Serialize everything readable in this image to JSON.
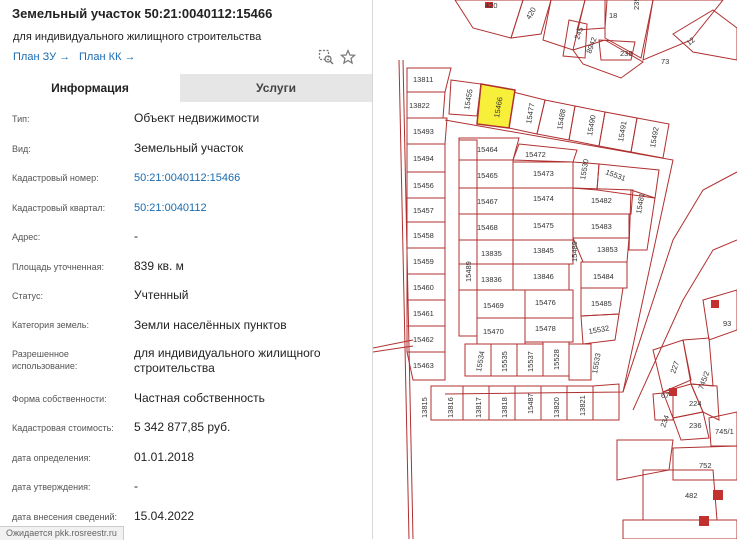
{
  "header": {
    "title": "Земельный участок 50:21:0040112:15466",
    "subtitle": "для индивидуального жилищного строительства",
    "plan_zu": "План ЗУ →",
    "plan_kk": "План КК →"
  },
  "tabs": [
    {
      "label": "Информация",
      "active": true
    },
    {
      "label": "Услуги",
      "active": false
    }
  ],
  "rows": [
    {
      "label": "Тип:",
      "value": "Объект недвижимости"
    },
    {
      "label": "Вид:",
      "value": "Земельный участок"
    },
    {
      "label": "Кадастровый номер:",
      "value": "50:21:0040112:15466"
    },
    {
      "label": "Кадастровый квартал:",
      "value": "50:21:0040112"
    },
    {
      "label": "Адрес:",
      "value": "-"
    },
    {
      "label": "Площадь уточненная:",
      "value": "839 кв. м"
    },
    {
      "label": "Статус:",
      "value": "Учтенный"
    },
    {
      "label": "Категория земель:",
      "value": "Земли населённых пунктов"
    },
    {
      "label": "Разрешенное использование:",
      "value": "для индивидуального жилищного строительства"
    },
    {
      "label": "Форма собственности:",
      "value": "Частная собственность"
    },
    {
      "label": "Кадастровая стоимость:",
      "value": "5 342 877,85 руб."
    },
    {
      "label": "дата определения:",
      "value": "01.01.2018"
    },
    {
      "label": "дата утверждения:",
      "value": "-"
    },
    {
      "label": "дата внесения сведений:",
      "value": "15.04.2022"
    }
  ],
  "status_bar": "Ожидается pkk.rosreestr.ru",
  "map": {
    "highlight_color": "#f7ef3a",
    "boundary_color": "#b03030",
    "plots": [
      "420",
      "420",
      "18",
      "239",
      "245",
      "8942",
      "238",
      "73",
      "12",
      "13811",
      "13822",
      "15455",
      "15466",
      "15477",
      "15488",
      "15490",
      "15491",
      "15492",
      "15493",
      "15494",
      "15456",
      "15457",
      "15458",
      "15459",
      "15460",
      "15461",
      "15462",
      "15463",
      "15464",
      "15472",
      "15530",
      "15531",
      "15465",
      "15473",
      "15467",
      "15474",
      "15482",
      "15481",
      "15468",
      "15475",
      "15483",
      "13835",
      "13845",
      "13853",
      "13836",
      "13846",
      "15484",
      "15489",
      "15489",
      "15469",
      "15476",
      "15485",
      "15470",
      "15478",
      "15532",
      "15534",
      "15535",
      "15537",
      "15528",
      "15533",
      "13815",
      "13816",
      "13817",
      "13818",
      "15487",
      "13820",
      "13821",
      "227",
      "745/2",
      "93",
      "224",
      "67",
      "234",
      "236",
      "745/1",
      "752",
      "482"
    ]
  }
}
